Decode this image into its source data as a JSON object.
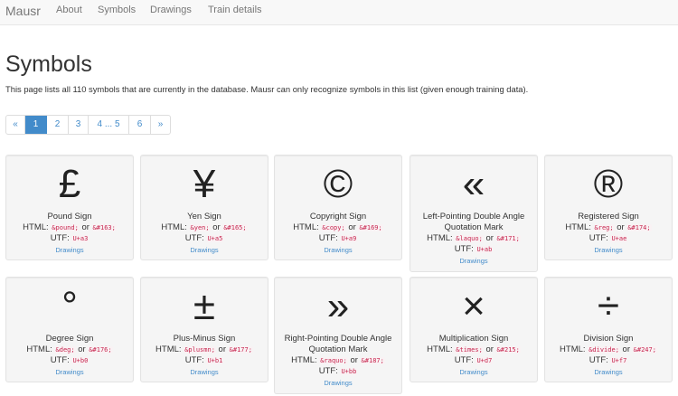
{
  "navbar": {
    "brand": "Mausr",
    "links": [
      "About",
      "Symbols",
      "Drawings",
      "Train details"
    ]
  },
  "page": {
    "title": "Symbols",
    "intro": "This page lists all 110 symbols that are currently in the database. Mausr can only recognize symbols in this list (given enough training data)."
  },
  "pagination": [
    "«",
    "1",
    "2",
    "3",
    "4 ... 5",
    "6",
    "»"
  ],
  "labels": {
    "html": "HTML:",
    "or": "or",
    "utf": "UTF:",
    "drawings": "Drawings"
  },
  "symbols": [
    {
      "glyph": "£",
      "name": "Pound Sign",
      "entity": "&pound;",
      "numeric": "&#163;",
      "utf": "U+a3"
    },
    {
      "glyph": "¥",
      "name": "Yen Sign",
      "entity": "&yen;",
      "numeric": "&#165;",
      "utf": "U+a5"
    },
    {
      "glyph": "©",
      "name": "Copyright Sign",
      "entity": "&copy;",
      "numeric": "&#169;",
      "utf": "U+a9"
    },
    {
      "glyph": "«",
      "name": "Left-Pointing Double Angle Quotation Mark",
      "entity": "&laquo;",
      "numeric": "&#171;",
      "utf": "U+ab"
    },
    {
      "glyph": "®",
      "name": "Registered Sign",
      "entity": "&reg;",
      "numeric": "&#174;",
      "utf": "U+ae"
    },
    {
      "glyph": "°",
      "name": "Degree Sign",
      "entity": "&deg;",
      "numeric": "&#176;",
      "utf": "U+b0"
    },
    {
      "glyph": "±",
      "name": "Plus-Minus Sign",
      "entity": "&plusmn;",
      "numeric": "&#177;",
      "utf": "U+b1"
    },
    {
      "glyph": "»",
      "name": "Right-Pointing Double Angle Quotation Mark",
      "entity": "&raquo;",
      "numeric": "&#187;",
      "utf": "U+bb"
    },
    {
      "glyph": "×",
      "name": "Multiplication Sign",
      "entity": "&times;",
      "numeric": "&#215;",
      "utf": "U+d7"
    },
    {
      "glyph": "÷",
      "name": "Division Sign",
      "entity": "&divide;",
      "numeric": "&#247;",
      "utf": "U+f7"
    }
  ]
}
